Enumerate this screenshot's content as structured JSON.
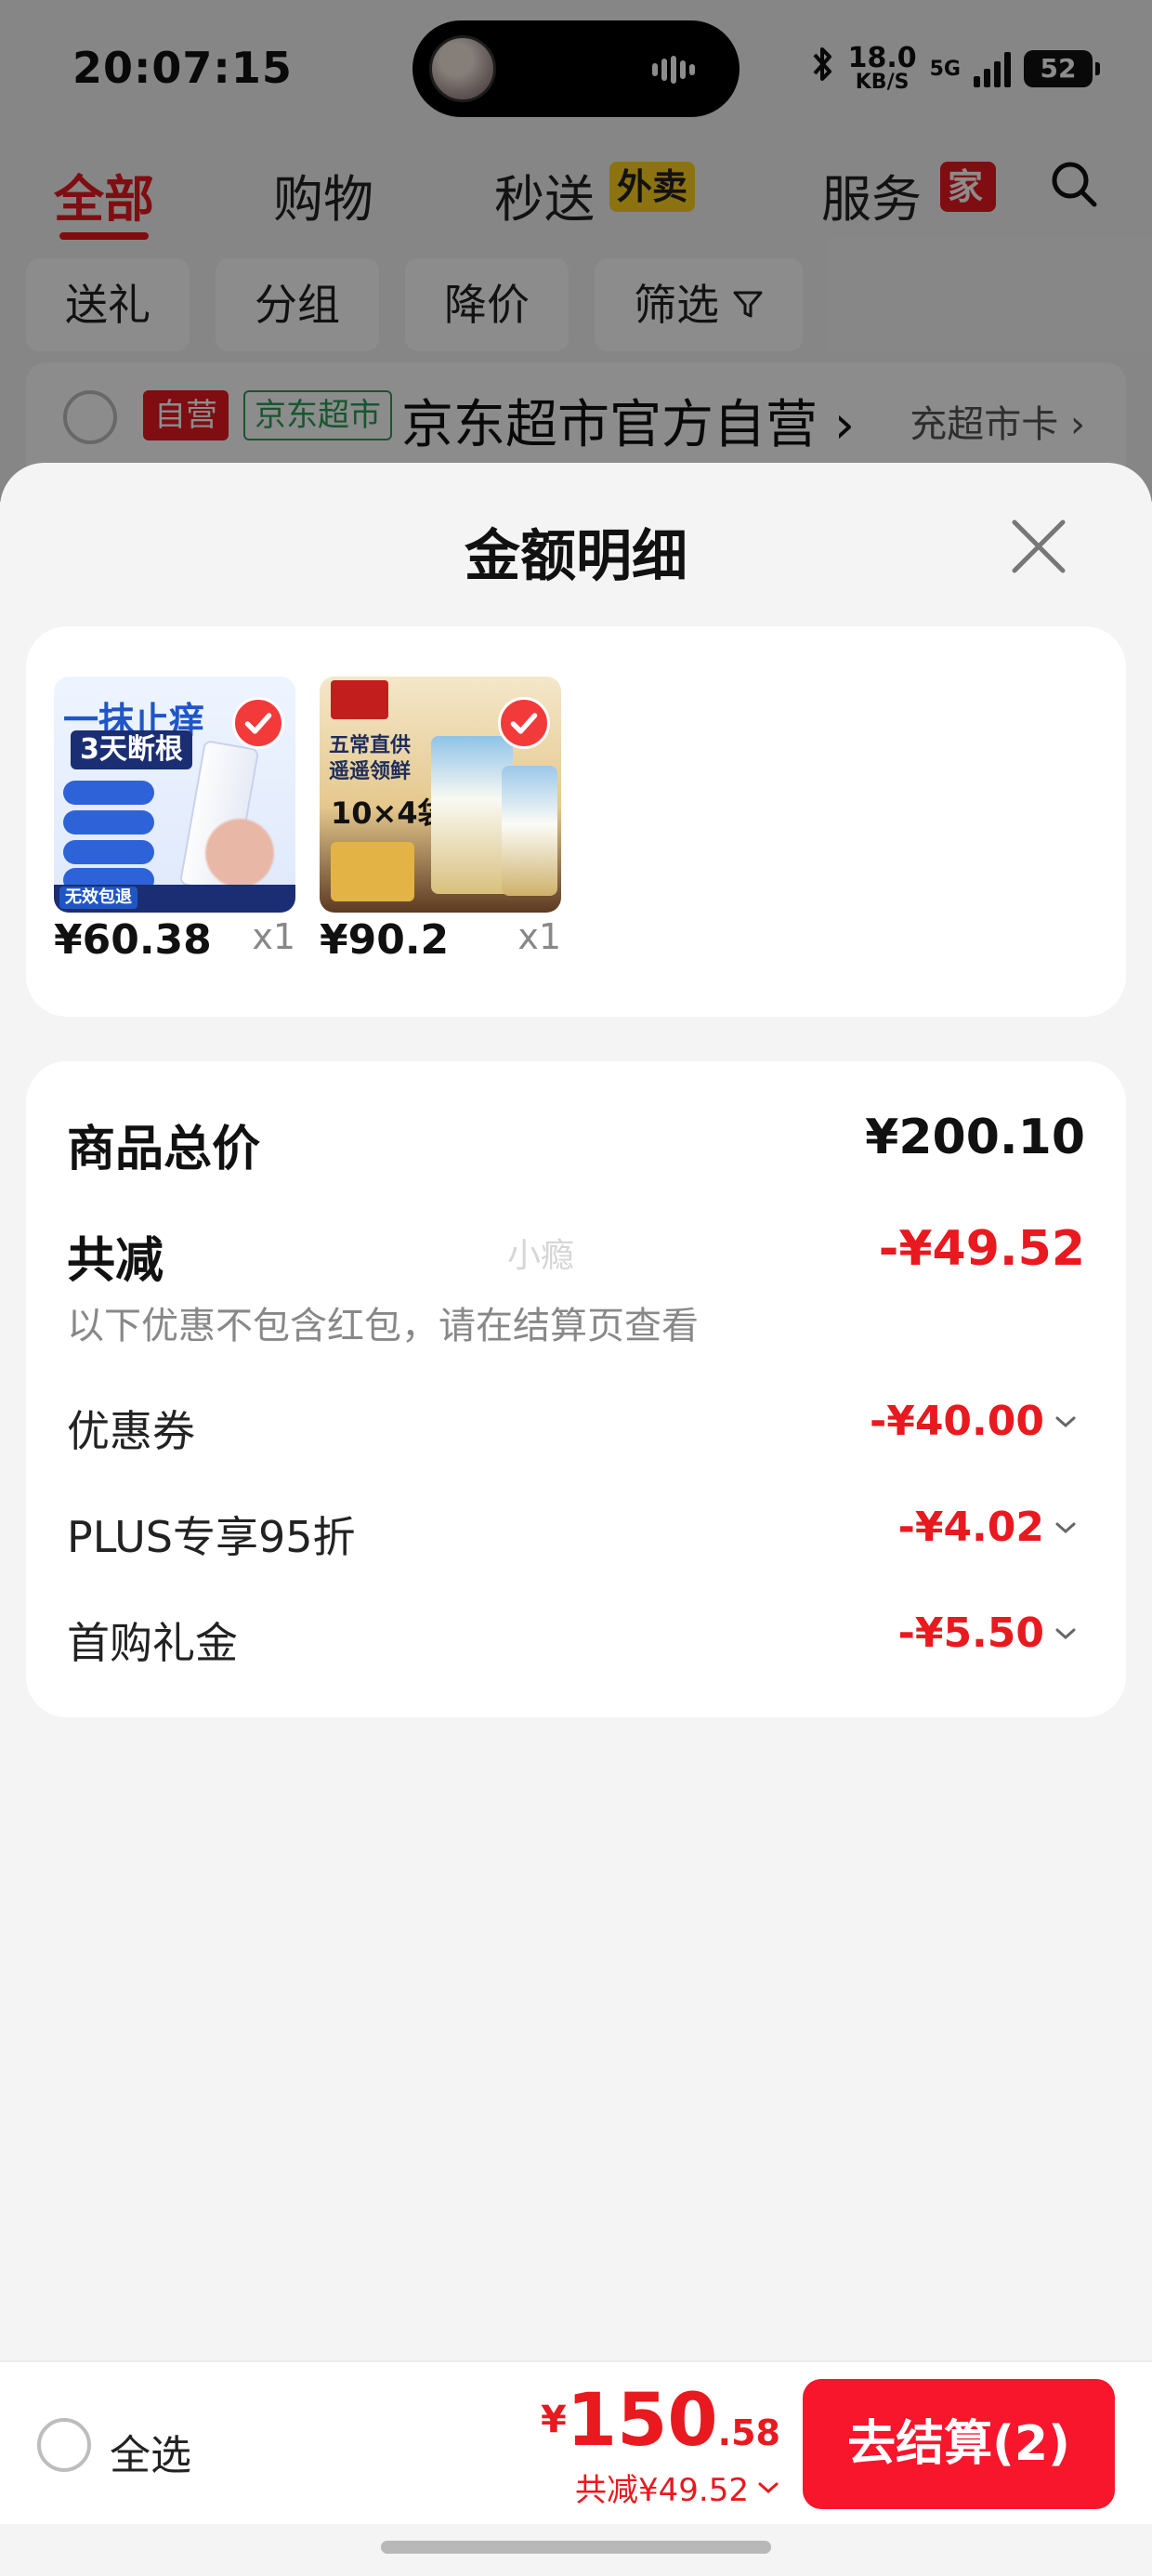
{
  "status_bar": {
    "time": "20:07:15",
    "network_speed": "18.0",
    "network_unit": "KB/S",
    "network_type": "5G",
    "battery": "52"
  },
  "top_tabs": [
    {
      "label": "全部",
      "active": true
    },
    {
      "label": "购物"
    },
    {
      "label": "秒送",
      "badge": "外卖"
    },
    {
      "label": "服务",
      "badge": "家"
    }
  ],
  "filters": [
    {
      "label": "送礼"
    },
    {
      "label": "分组"
    },
    {
      "label": "降价"
    },
    {
      "label": "筛选",
      "icon": "filter-icon"
    }
  ],
  "shop": {
    "self_badge": "自营",
    "market_badge": "京东超市",
    "name": "京东超市官方自营",
    "card_link": "充超市卡"
  },
  "sheet": {
    "title": "金额明细",
    "products": [
      {
        "price": "¥60.38",
        "qty": "x1",
        "image_texts": [
          "一抹止痒",
          "3天断根",
          "无效包退"
        ],
        "selected": true
      },
      {
        "price": "¥90.2",
        "qty": "x1",
        "image_texts": [
          "五常直供",
          "遥遥领鲜",
          "10×4袋"
        ],
        "selected": true
      }
    ],
    "summary": {
      "total_label": "商品总价",
      "total_value": "¥200.10",
      "discount_label": "共减",
      "discount_value": "-¥49.52",
      "discount_note": "以下优惠不包含红包，请在结算页查看",
      "watermark": "小瘾",
      "details": [
        {
          "label": "优惠券",
          "value": "-¥40.00"
        },
        {
          "label": "PLUS专享95折",
          "value": "-¥4.02"
        },
        {
          "label": "首购礼金",
          "value": "-¥5.50"
        }
      ]
    }
  },
  "action_bar": {
    "select_all": "全选",
    "price_symbol": "¥",
    "price_int": "150",
    "price_dec": ".58",
    "discount_text": "共减¥49.52",
    "checkout_label": "去结算(2)"
  },
  "colors": {
    "accent_red": "#e8191f",
    "checkout_red": "#f7162c",
    "market_green": "#2a9d58"
  }
}
